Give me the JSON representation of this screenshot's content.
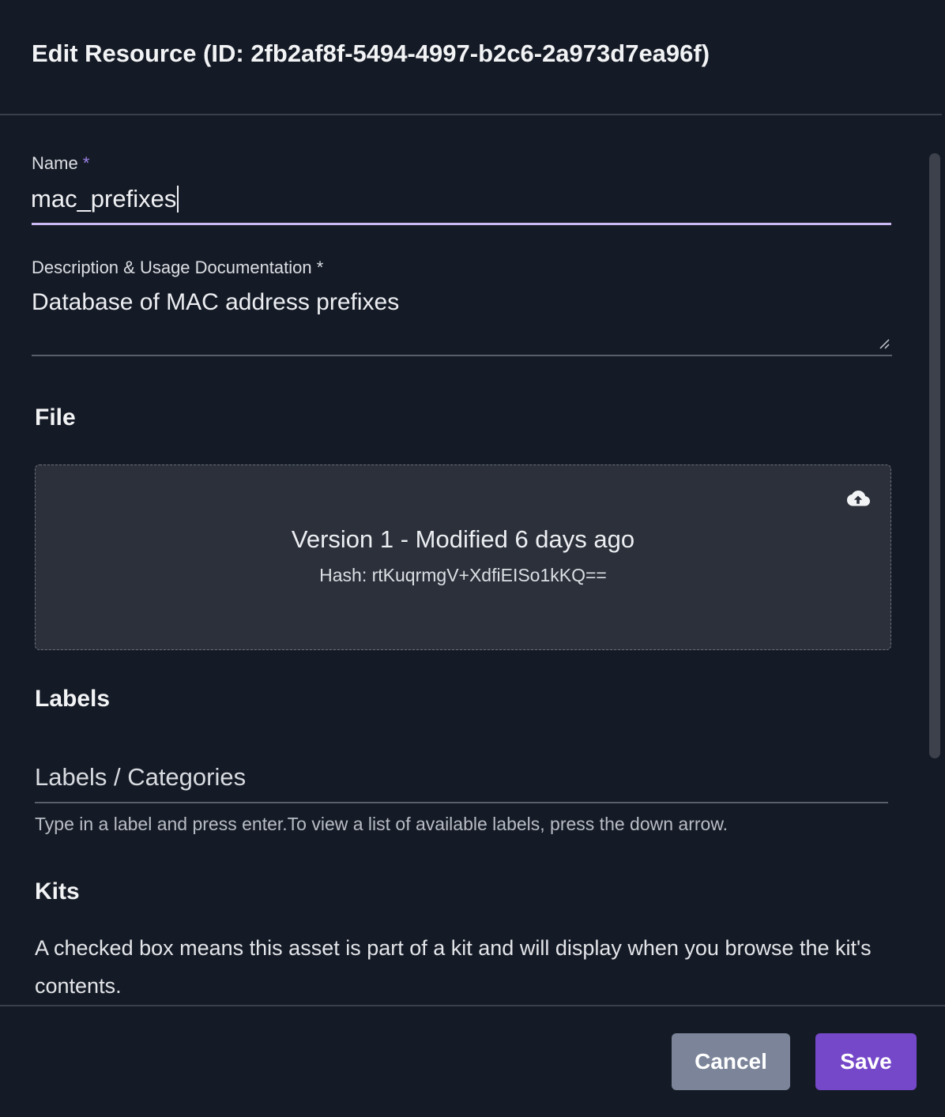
{
  "dialog": {
    "title": "Edit Resource (ID: 2fb2af8f-5494-4997-b2c6-2a973d7ea96f)"
  },
  "form": {
    "name": {
      "label": "Name",
      "required_mark": "*",
      "value": "mac_prefixes"
    },
    "description": {
      "label": "Description & Usage Documentation *",
      "value": "Database of MAC address prefixes"
    }
  },
  "file_section": {
    "title": "File",
    "version_text": "Version 1 - Modified 6 days ago",
    "hash_text": "Hash: rtKuqrmgV+XdfiEISo1kKQ==",
    "upload_icon": "cloud-upload-icon"
  },
  "labels_section": {
    "title": "Labels",
    "input_placeholder": "Labels / Categories",
    "helper": "Type in a label and press enter.To view a list of available labels, press the down arrow."
  },
  "kits_section": {
    "title": "Kits",
    "description": "A checked box means this asset is part of a kit and will display when you browse the kit's contents."
  },
  "footer": {
    "cancel_label": "Cancel",
    "save_label": "Save"
  },
  "colors": {
    "background": "#151b26",
    "accent": "#7548c9",
    "focus_underline": "#cbb8f2",
    "cancel_button": "#7b8499"
  }
}
